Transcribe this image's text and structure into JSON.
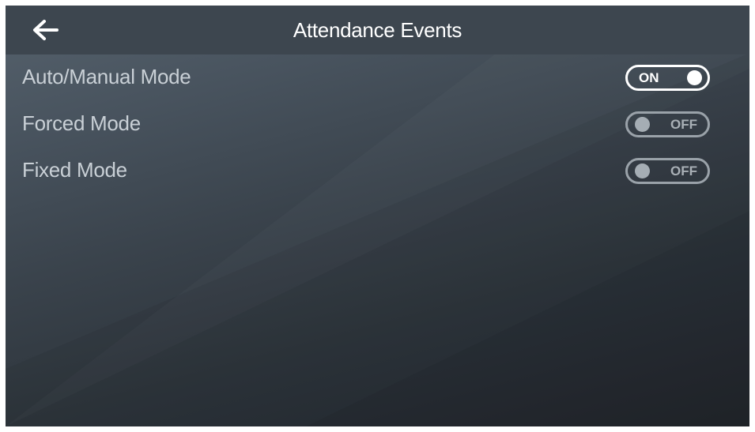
{
  "header": {
    "back_icon": "arrow-left-icon",
    "title": "Attendance Events"
  },
  "settings": [
    {
      "label": "Auto/Manual Mode",
      "toggle_state": "on",
      "toggle_text": "ON"
    },
    {
      "label": "Forced Mode",
      "toggle_state": "off",
      "toggle_text": "OFF"
    },
    {
      "label": "Fixed Mode",
      "toggle_state": "off",
      "toggle_text": "OFF"
    }
  ],
  "colors": {
    "header_bg": "#3d464f",
    "text_primary": "#ffffff",
    "text_secondary": "#c9d0d6",
    "toggle_off": "#9aa2a9"
  }
}
